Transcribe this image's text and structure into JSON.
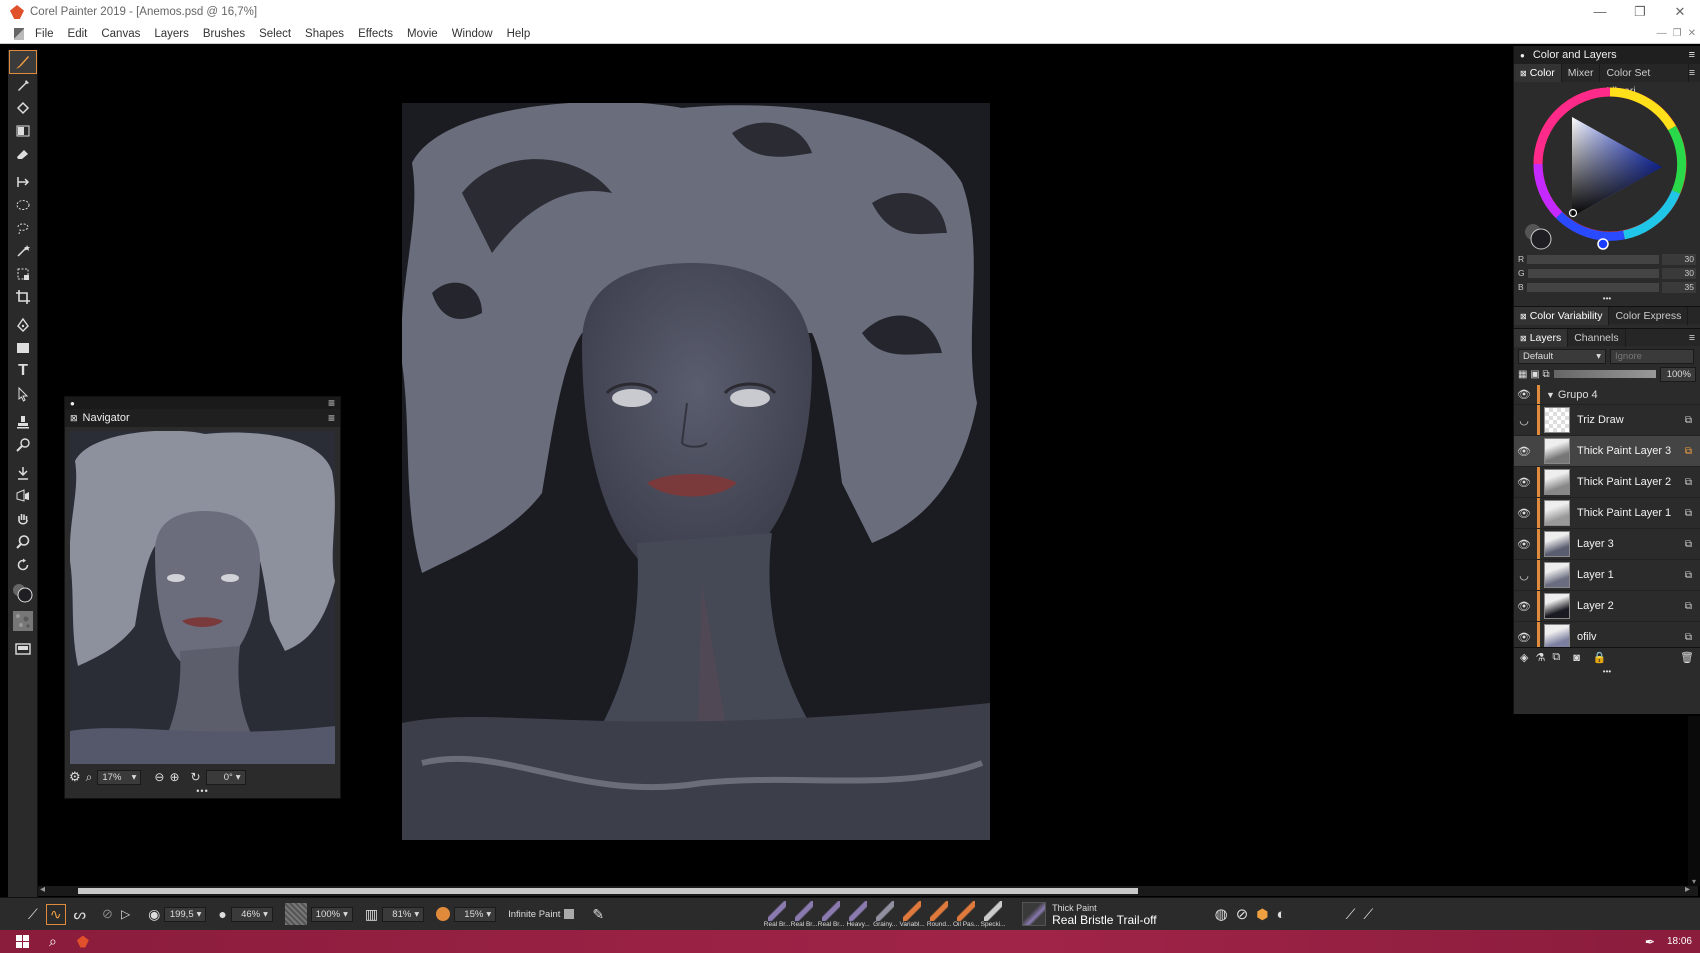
{
  "window": {
    "title": "Corel Painter 2019 - [Anemos.psd @ 16,7%]",
    "controls": [
      "—",
      "❐",
      "✕"
    ]
  },
  "menu": [
    "File",
    "Edit",
    "Canvas",
    "Layers",
    "Brushes",
    "Select",
    "Shapes",
    "Effects",
    "Movie",
    "Window",
    "Help"
  ],
  "navigator": {
    "title": "Navigator",
    "zoom": "17%",
    "rotation": "0°"
  },
  "color_panel": {
    "group_title": "Color and Layers",
    "tabs": [
      "Color",
      "Mixer",
      "Color Set Librari"
    ],
    "rgb": [
      {
        "label": "R",
        "value": "30"
      },
      {
        "label": "G",
        "value": "30"
      },
      {
        "label": "B",
        "value": "35"
      }
    ],
    "subtabs": [
      "Color Variability",
      "Color Express"
    ]
  },
  "layers_panel": {
    "tabs": [
      "Layers",
      "Channels"
    ],
    "composite_method": "Default",
    "preserve": "Ignore",
    "opacity": "100%",
    "group_name": "Grupo 4",
    "layers": [
      {
        "name": "Triz Draw",
        "visible": false,
        "selected": false
      },
      {
        "name": "Thick Paint Layer 3",
        "visible": true,
        "selected": true
      },
      {
        "name": "Thick Paint Layer 2",
        "visible": true,
        "selected": false
      },
      {
        "name": "Thick Paint Layer 1",
        "visible": true,
        "selected": false
      },
      {
        "name": "Layer 3",
        "visible": true,
        "selected": false
      },
      {
        "name": "Layer 1",
        "visible": false,
        "selected": false
      },
      {
        "name": "Layer 2",
        "visible": true,
        "selected": false
      },
      {
        "name": "ofilv",
        "visible": true,
        "selected": false
      }
    ]
  },
  "property_bar": {
    "size": "199,5",
    "opacity": "46%",
    "grain": "100%",
    "stroke_amount": "81%",
    "paint_amount": "15%",
    "infinite_paint_label": "Infinite Paint",
    "brushes": [
      "Real Br...",
      "Real Br...",
      "Real Br...",
      "Heavy...",
      "Grainy...",
      "Variabl...",
      "Round...",
      "Oil Pas...",
      "Specki..."
    ],
    "current_category": "Thick Paint",
    "current_variant": "Real Bristle Trail-off"
  },
  "taskbar": {
    "time": "18:06"
  },
  "colors": {
    "accent": "#e08a3c",
    "panel_bg": "#2b2b2b",
    "taskbar": "#a02448",
    "current_color": "#1e1e23"
  },
  "icons": [
    "brush-icon",
    "dropper-icon",
    "paint-bucket-icon",
    "gradient-icon",
    "eraser-icon",
    "move-icon",
    "ellipse-select-icon",
    "lasso-icon",
    "magic-wand-icon",
    "transform-icon",
    "crop-icon",
    "pen-icon",
    "rectangle-icon",
    "text-icon",
    "selection-arrow-icon",
    "clone-icon",
    "blender-icon",
    "dodge-icon",
    "mirror-icon",
    "grabber-icon",
    "magnifier-icon",
    "rotate-icon"
  ]
}
